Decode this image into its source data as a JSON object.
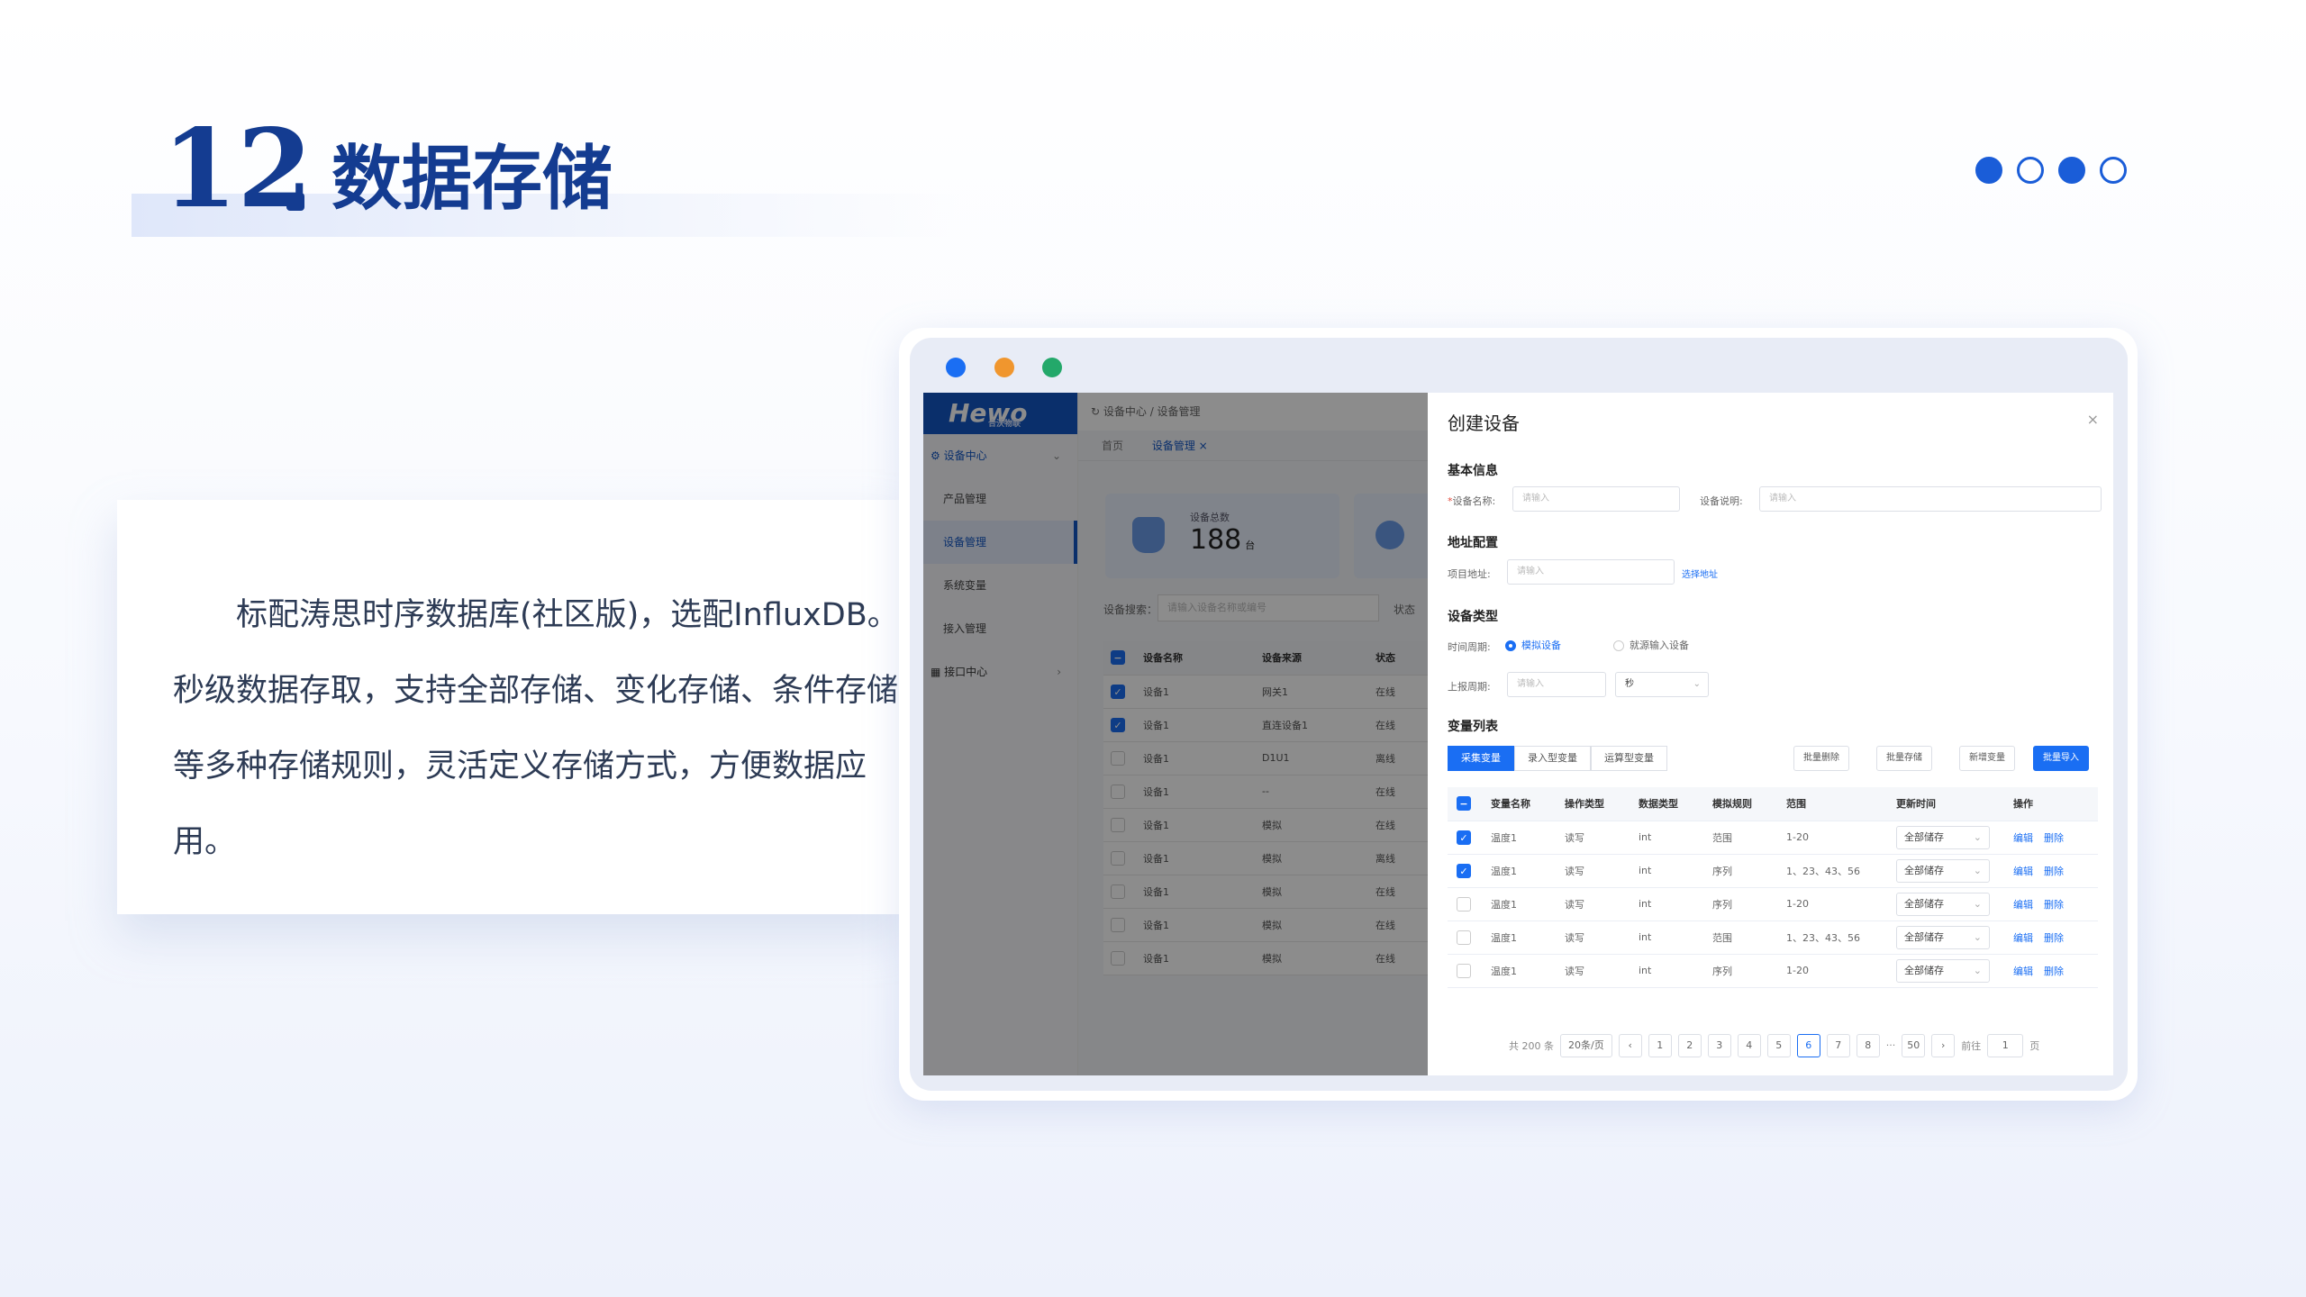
{
  "slide": {
    "number": "12",
    "title": "数据存储",
    "description": "标配涛思时序数据库(社区版)，选配InfluxDB。秒级数据存取，支持全部存储、变化存储、条件存储等多种存储规则，灵活定义存储方式，方便数据应用。"
  },
  "colors": {
    "brand": "#143c91",
    "accent": "#1a6ef3",
    "mac_dots": [
      "#1a6ef3",
      "#f0962e",
      "#23a86a"
    ]
  },
  "app": {
    "logo": "Hewo",
    "logo_sub": "合沃物联",
    "sidebar": {
      "group": "设备中心",
      "items": [
        "产品管理",
        "设备管理",
        "系统变量",
        "接入管理"
      ],
      "group2": "接口中心"
    },
    "breadcrumb": "设备中心 / 设备管理",
    "tabs": [
      "首页",
      "设备管理 ×"
    ],
    "stat": {
      "label": "设备总数",
      "value": "188",
      "unit": "台"
    },
    "search_label": "设备搜索：",
    "search_placeholder": "请输入设备名称或编号",
    "status_label": "状态",
    "device_table": {
      "headers": [
        "设备名称",
        "设备来源",
        "状态"
      ],
      "rows": [
        {
          "name": "设备1",
          "source": "网关1",
          "status": "在线",
          "checked": true
        },
        {
          "name": "设备1",
          "source": "直连设备1",
          "status": "在线",
          "checked": true
        },
        {
          "name": "设备1",
          "source": "D1U1",
          "status": "离线",
          "checked": false
        },
        {
          "name": "设备1",
          "source": "--",
          "status": "在线",
          "checked": false
        },
        {
          "name": "设备1",
          "source": "模拟",
          "status": "在线",
          "checked": false
        },
        {
          "name": "设备1",
          "source": "模拟",
          "status": "离线",
          "checked": false
        },
        {
          "name": "设备1",
          "source": "模拟",
          "status": "在线",
          "checked": false
        },
        {
          "name": "设备1",
          "source": "模拟",
          "status": "在线",
          "checked": false
        },
        {
          "name": "设备1",
          "source": "模拟",
          "status": "在线",
          "checked": false
        }
      ]
    }
  },
  "drawer": {
    "title": "创建设备",
    "close": "×",
    "basic_info": "基本信息",
    "req_mark": "*",
    "device_name_label": "设备名称:",
    "device_name_placeholder": "请输入",
    "device_desc_label": "设备说明:",
    "device_desc_placeholder": "请输入",
    "address_section": "地址配置",
    "project_addr_label": "项目地址:",
    "project_addr_placeholder": "请输入",
    "choose_addr": "选择地址",
    "device_type_section": "设备类型",
    "time_period_label": "时间周期:",
    "radio_sim": "模拟设备",
    "radio_input": "就源输入设备",
    "report_period_label": "上报周期:",
    "report_placeholder": "请输入",
    "report_unit": "秒",
    "var_list_section": "变量列表",
    "var_tabs": [
      "采集变量",
      "录入型变量",
      "运算型变量"
    ],
    "action_buttons": [
      "批量删除",
      "批量存储",
      "新增变量",
      "批量导入"
    ],
    "var_table": {
      "headers": [
        "变量名称",
        "操作类型",
        "数据类型",
        "模拟规则",
        "范围",
        "更新时间",
        "操作"
      ],
      "rows": [
        {
          "name": "温度1",
          "op": "读写",
          "type": "int",
          "rule": "范围",
          "range": "1-20",
          "update": "全部储存",
          "checked": true
        },
        {
          "name": "温度1",
          "op": "读写",
          "type": "int",
          "rule": "序列",
          "range": "1、23、43、56",
          "update": "全部储存",
          "checked": true
        },
        {
          "name": "温度1",
          "op": "读写",
          "type": "int",
          "rule": "序列",
          "range": "1-20",
          "update": "全部储存",
          "checked": false
        },
        {
          "name": "温度1",
          "op": "读写",
          "type": "int",
          "rule": "范围",
          "range": "1、23、43、56",
          "update": "全部储存",
          "checked": false
        },
        {
          "name": "温度1",
          "op": "读写",
          "type": "int",
          "rule": "序列",
          "range": "1-20",
          "update": "全部储存",
          "checked": false
        }
      ],
      "edit": "编辑",
      "delete": "删除"
    },
    "pagination": {
      "total": "共 200 条",
      "page_size": "20条/页",
      "prev": "‹",
      "pages": [
        "1",
        "2",
        "3",
        "4",
        "5",
        "6",
        "7",
        "8",
        "···",
        "50"
      ],
      "current": "6",
      "next": "›",
      "goto_label": "前往",
      "goto_value": "1",
      "goto_suffix": "页"
    }
  }
}
